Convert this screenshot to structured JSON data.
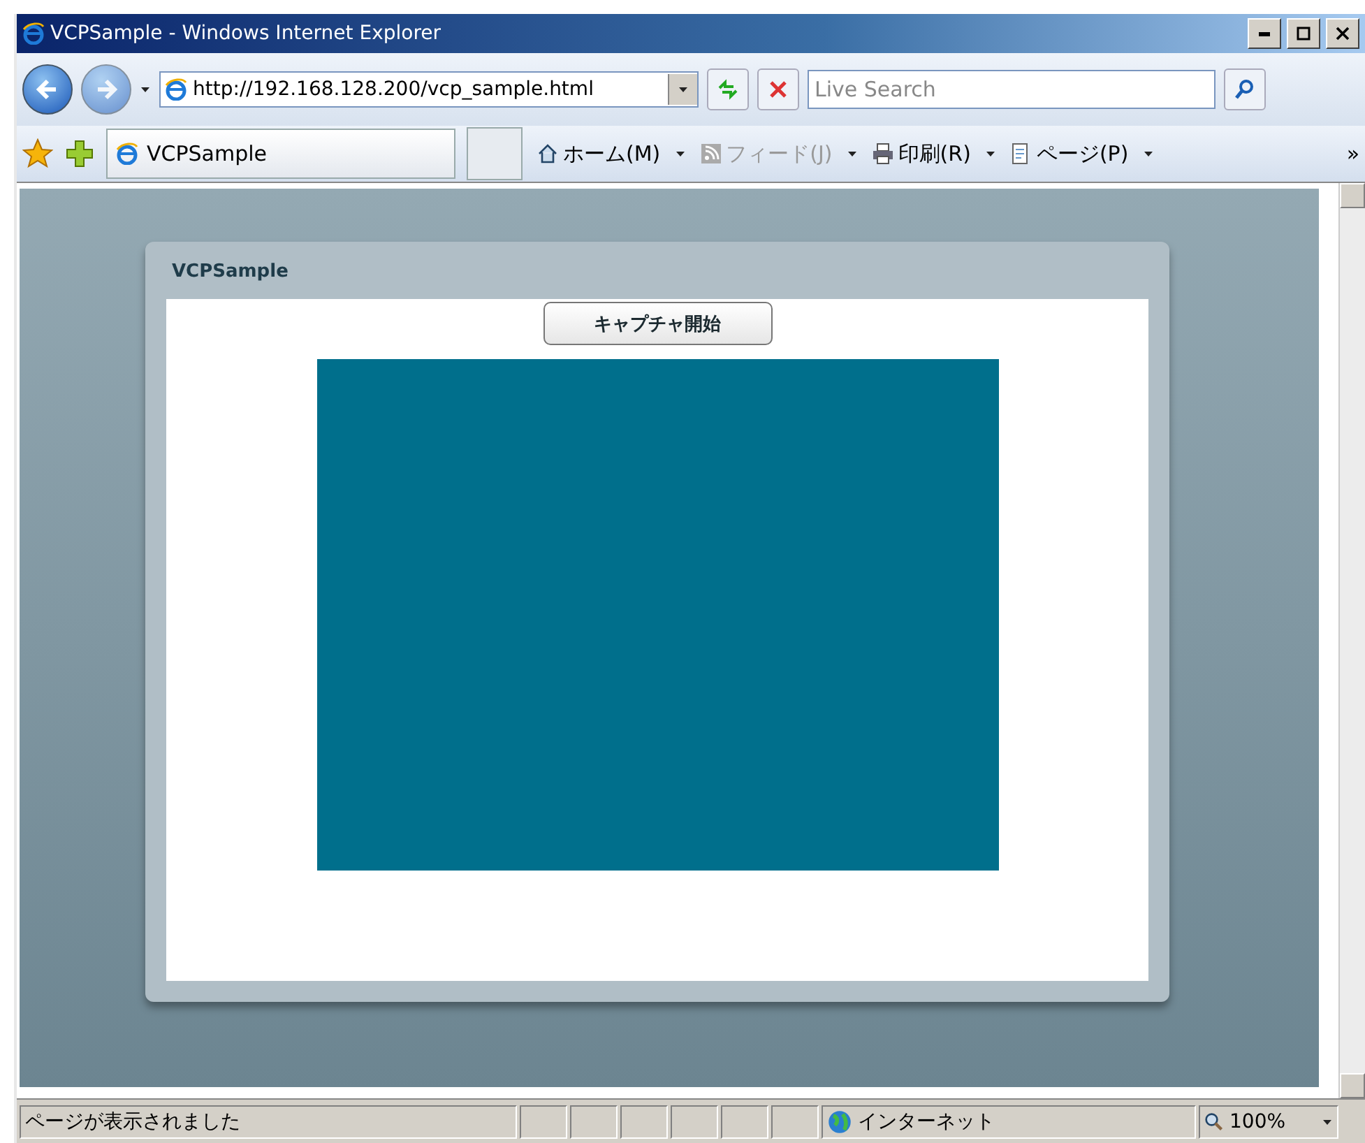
{
  "window": {
    "title": "VCPSample - Windows Internet Explorer"
  },
  "address": {
    "url": "http://192.168.128.200/vcp_sample.html"
  },
  "search": {
    "placeholder": "Live Search"
  },
  "tab": {
    "title": "VCPSample",
    "selected": true
  },
  "commands": [
    {
      "kind": "home",
      "label": "ホーム(M)",
      "disabled": false
    },
    {
      "kind": "feed",
      "label": "フィード(J)",
      "disabled": true
    },
    {
      "kind": "print",
      "label": "印刷(R)",
      "disabled": false
    },
    {
      "kind": "page",
      "label": "ページ(P)",
      "disabled": false
    }
  ],
  "more": "»",
  "page": {
    "panel_title": "VCPSample",
    "button": "キャプチャ開始"
  },
  "status": {
    "text": "ページが表示されました",
    "zone": "インターネット",
    "zoom": "100%"
  }
}
